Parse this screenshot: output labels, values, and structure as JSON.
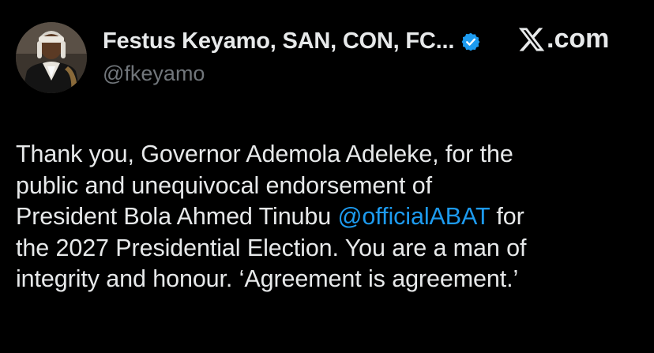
{
  "author": {
    "display_name": "Festus Keyamo, SAN, CON, FC...",
    "handle": "@fkeyamo",
    "verified": true,
    "avatar_icon": "profile-photo"
  },
  "brand": {
    "label": ".com",
    "icon": "x-logo-icon"
  },
  "tweet": {
    "lines": [
      {
        "text": "Thank you, Governor Ademola Adeleke, for the"
      },
      {
        "text": "public and unequivocal endorsement of"
      },
      {
        "pre": "President Bola Ahmed Tinubu ",
        "mention": "@officialABAT",
        "post": " for"
      },
      {
        "text": "the 2027 Presidential Election. You are a man of"
      },
      {
        "text": "integrity and honour. ‘Agreement is agreement.’"
      }
    ]
  },
  "colors": {
    "background": "#000000",
    "text": "#e7e9ea",
    "muted": "#71767b",
    "accent": "#1d9bf0"
  }
}
